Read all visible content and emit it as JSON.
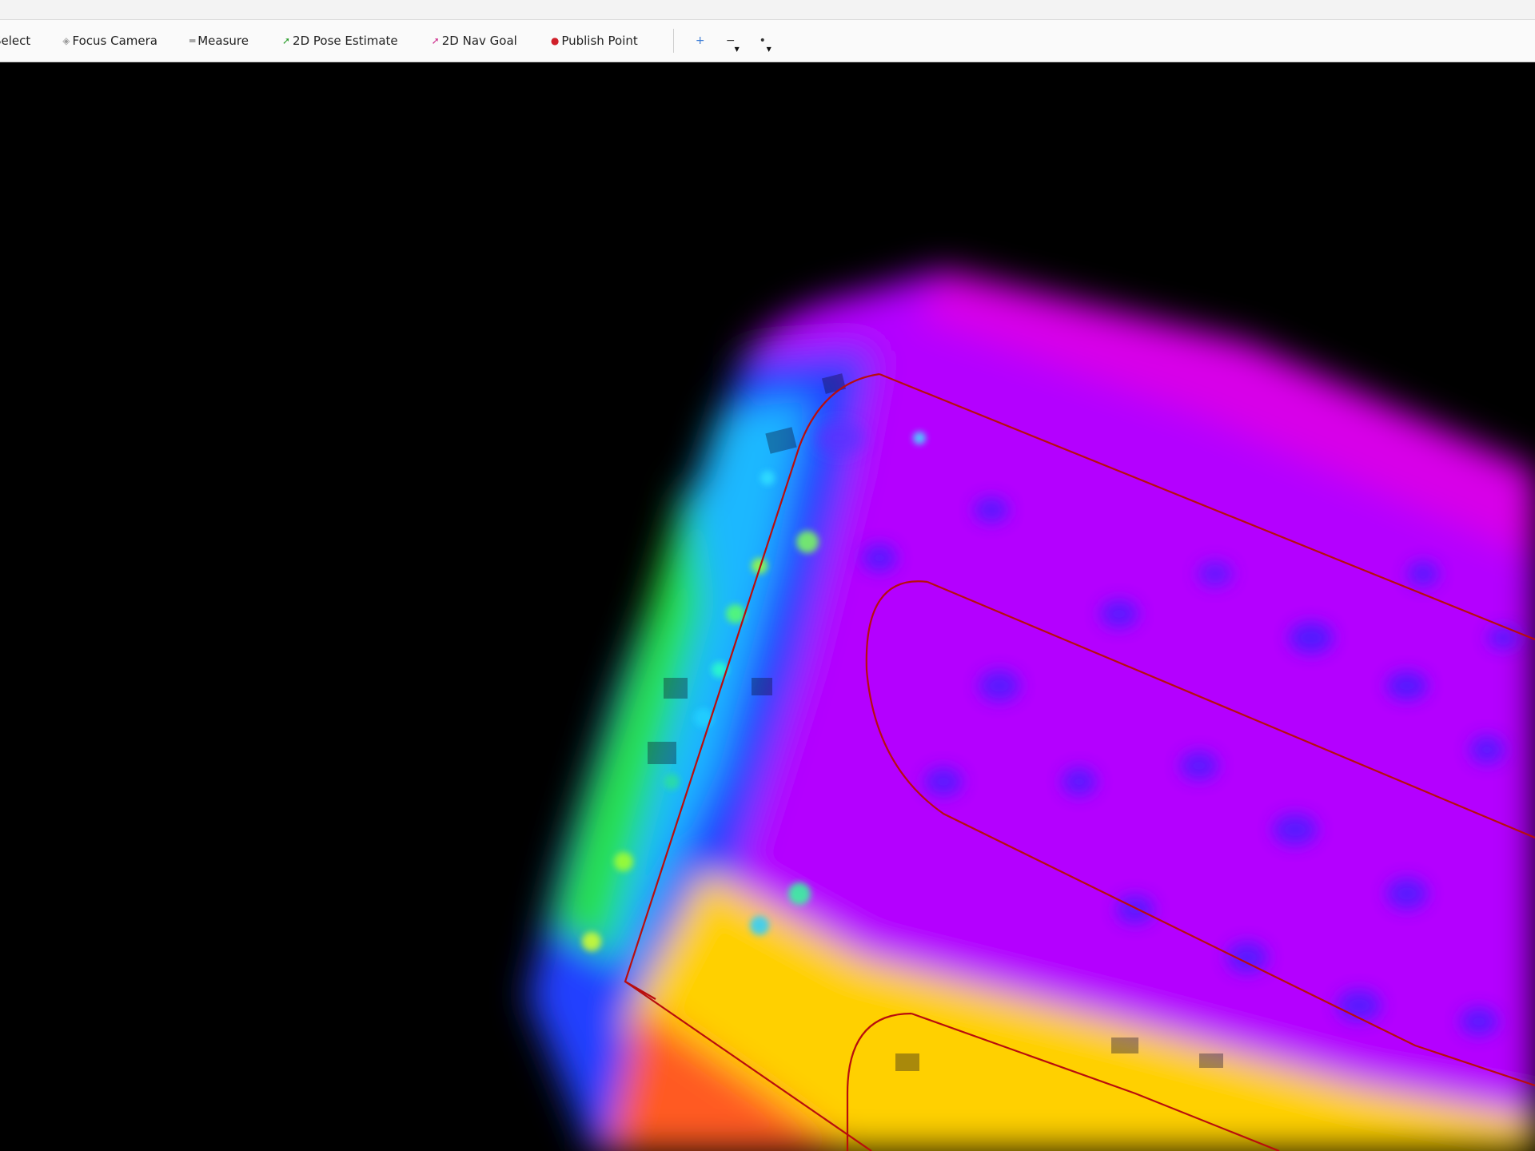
{
  "toolbar": {
    "tools": [
      {
        "label": "Select",
        "icon": "select-cursor-icon"
      },
      {
        "label": "Focus Camera",
        "icon": "focus-camera-icon",
        "color": "#9a9a9a"
      },
      {
        "label": "Measure",
        "icon": "measure-icon",
        "color": "#555555"
      },
      {
        "label": "2D Pose Estimate",
        "icon": "pose-estimate-arrow-icon",
        "color": "#2a9d2a"
      },
      {
        "label": "2D Nav Goal",
        "icon": "nav-goal-arrow-icon",
        "color": "#cc2a8a"
      },
      {
        "label": "Publish Point",
        "icon": "publish-point-pin-icon",
        "color": "#d0202a"
      }
    ],
    "extra_icons": [
      "add-tool-icon",
      "remove-tool-icon",
      "tool-properties-icon"
    ]
  },
  "viewport": {
    "background": "#000000",
    "point_cloud_colormap": [
      "#ff3b1c",
      "#ffd400",
      "#2ee83a",
      "#1fd5ff",
      "#2a3cff",
      "#7a16ff",
      "#c200ff",
      "#e000e6"
    ],
    "path_color": "#cc1212"
  }
}
